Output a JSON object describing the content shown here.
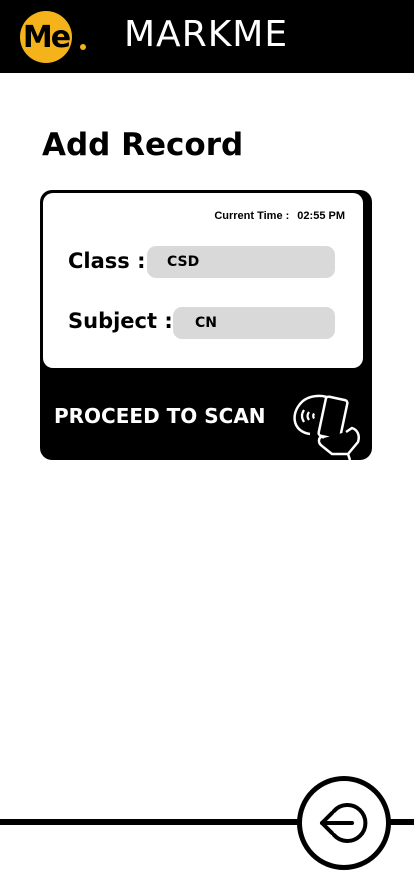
{
  "header": {
    "logo_text": "Me",
    "app_title": "MARKME"
  },
  "main": {
    "page_title": "Add Record"
  },
  "record_card": {
    "current_time_label": "Current Time :",
    "current_time_value": "02:55 PM",
    "class_label": "Class :",
    "class_value": "CSD",
    "subject_label": "Subject :",
    "subject_value": "CN",
    "scan_label": "PROCEED TO SCAN",
    "scan_icon": "nfc-phone-scan-icon"
  },
  "footer": {
    "back_icon": "logout-arrow-icon"
  },
  "colors": {
    "brand_yellow": "#f4b21b",
    "header_bg": "#000000",
    "pill_bg": "#d9d9d9"
  }
}
